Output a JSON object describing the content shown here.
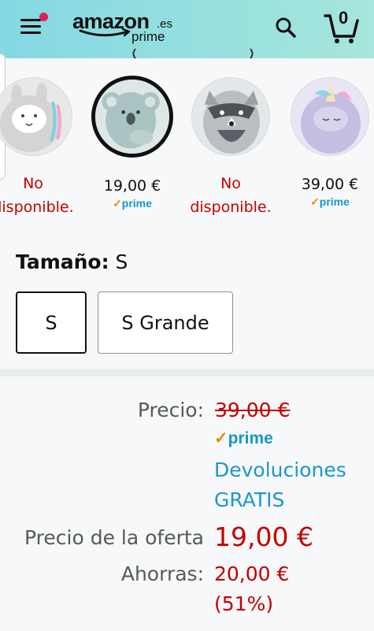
{
  "header": {
    "logo_word": "amazon",
    "logo_tld": ".es",
    "logo_prime": "prime",
    "cart_count": "0",
    "icons": [
      "hamburger-menu-icon",
      "search-icon",
      "cart-icon"
    ],
    "notification_color": "#e31c5f"
  },
  "swatches": [
    {
      "availability": "No disponible.",
      "image": "llama-backpack",
      "selected": false
    },
    {
      "price": "19,00 €",
      "prime": "prime",
      "image": "koala-backpack",
      "selected": true
    },
    {
      "availability": "No disponible.",
      "image": "raccoon-backpack",
      "selected": false
    },
    {
      "price": "39,00 €",
      "prime": "prime",
      "image": "unicorn-backpack",
      "selected": false
    }
  ],
  "size": {
    "label": "Tamaño:",
    "selected_value": "S",
    "options": [
      "S",
      "S Grande"
    ]
  },
  "pricing": {
    "list_label": "Precio:",
    "list_price": "39,00 €",
    "prime": "prime",
    "returns_line1": "Devoluciones",
    "returns_line2": "GRATIS",
    "deal_label": "Precio de la oferta",
    "deal_price": "19,00 €",
    "savings_label": "Ahorras:",
    "savings_amount": "20,00 €",
    "savings_percent": "(51%)"
  },
  "colors": {
    "header_gradient_start": "#84d8e3",
    "header_gradient_end": "#a6e6dc",
    "price_red": "#c40000",
    "link_blue": "#1a98c8",
    "prime_blue": "#1399c6",
    "prime_orange": "#f08804"
  }
}
